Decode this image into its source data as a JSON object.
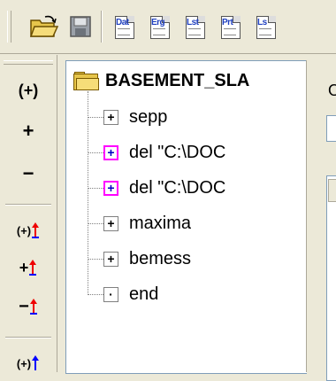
{
  "toolbar": {
    "buttons": [
      {
        "name": "open-folder-icon"
      },
      {
        "name": "save-icon"
      },
      {
        "name": "dat-doc-icon",
        "label": "Dat"
      },
      {
        "name": "erg-doc-icon",
        "label": "Erg"
      },
      {
        "name": "lst-doc-icon",
        "label": "Lst"
      },
      {
        "name": "prt-doc-icon",
        "label": "Prt"
      },
      {
        "name": "ls-doc-icon",
        "label": "Ls"
      }
    ]
  },
  "left_toolbar": {
    "buttons": [
      {
        "name": "expand-all-button",
        "label": "(+)"
      },
      {
        "name": "expand-button",
        "label": "+"
      },
      {
        "name": "collapse-button",
        "label": "−"
      },
      {
        "name": "expand-all-up-button",
        "label": "(+)"
      },
      {
        "name": "add-up-button",
        "label": "+"
      },
      {
        "name": "remove-up-button",
        "label": "−"
      },
      {
        "name": "expand-all-up-button-2",
        "label": "(+)"
      }
    ]
  },
  "tree": {
    "root_label": "BASEMENT_SLA",
    "nodes": [
      {
        "label": "sepp",
        "symbol": "+",
        "style": "normal"
      },
      {
        "label": "del \"C:\\DOC",
        "symbol": "+",
        "style": "pink"
      },
      {
        "label": "del \"C:\\DOC",
        "symbol": "+",
        "style": "pink"
      },
      {
        "label": "maxima",
        "symbol": "+",
        "style": "normal"
      },
      {
        "label": "bemess",
        "symbol": "+",
        "style": "normal"
      },
      {
        "label": "end",
        "symbol": "·",
        "style": "normal"
      }
    ]
  },
  "right_panel": {
    "label": "O"
  }
}
